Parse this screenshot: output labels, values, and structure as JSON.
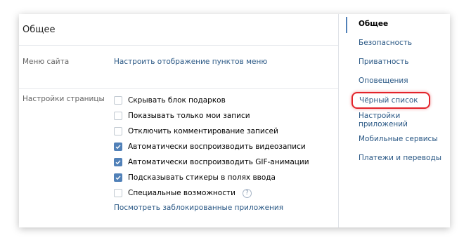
{
  "header": {
    "title": "Общее"
  },
  "menu_row": {
    "label": "Меню сайта",
    "link": "Настроить отображение пунктов меню"
  },
  "page_settings": {
    "label": "Настройки страницы",
    "options": [
      {
        "label": "Скрывать блок подарков",
        "checked": false
      },
      {
        "label": "Показывать только мои записи",
        "checked": false
      },
      {
        "label": "Отключить комментирование записей",
        "checked": false
      },
      {
        "label": "Автоматически воспроизводить видеозаписи",
        "checked": true
      },
      {
        "label": "Автоматически воспроизводить GIF-анимации",
        "checked": true
      },
      {
        "label": "Подсказывать стикеры в полях ввода",
        "checked": true
      },
      {
        "label": "Специальные возможности",
        "checked": false
      }
    ],
    "help_symbol": "?",
    "bottom_link": "Посмотреть заблокированные приложения"
  },
  "nav": {
    "items": [
      {
        "label": "Общее",
        "active": true
      },
      {
        "label": "Безопасность"
      },
      {
        "label": "Приватность"
      },
      {
        "label": "Оповещения"
      },
      {
        "label": "Чёрный список",
        "highlighted": true
      },
      {
        "label": "Настройки приложений"
      },
      {
        "label": "Мобильные сервисы"
      },
      {
        "label": "Платежи и переводы"
      }
    ]
  },
  "colors": {
    "accent": "#5181b8",
    "link": "#2a5885",
    "highlight_border": "#e3242b"
  },
  "icons": {
    "checkbox_check": "check-icon",
    "help": "question-circle-icon"
  }
}
